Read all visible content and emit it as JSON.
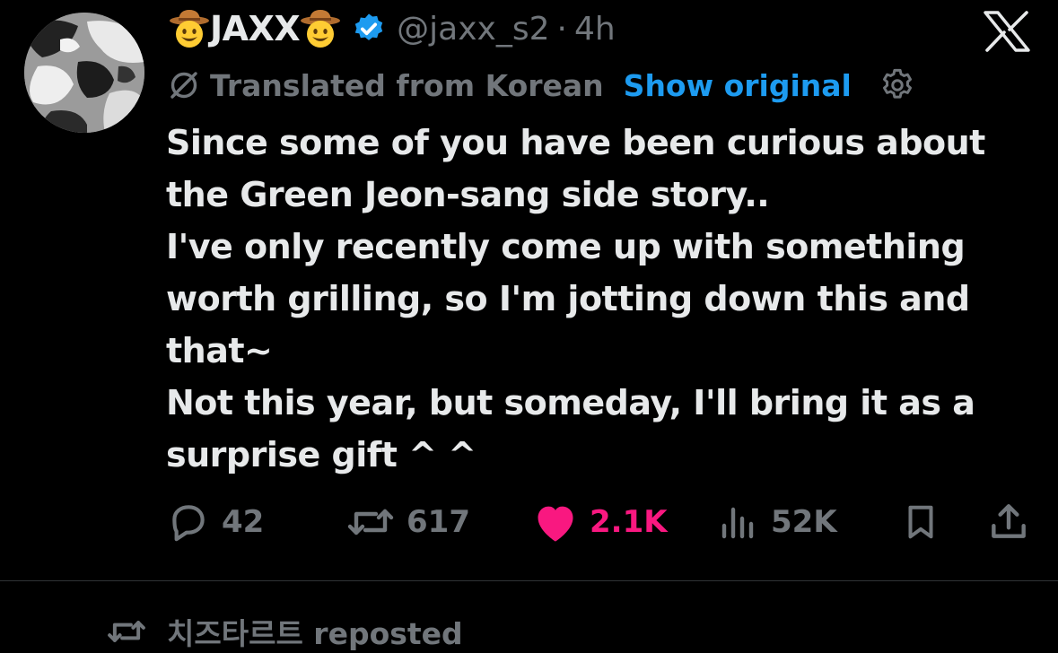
{
  "tweet": {
    "display_name": "JAXX",
    "name_emoji": "cowboy-face",
    "verified": true,
    "handle": "@jaxx_s2",
    "separator": "·",
    "time": "4h",
    "translation": {
      "label": "Translated from Korean",
      "show_original": "Show original"
    },
    "body_lines": [
      "Since some of you have been curious about",
      "the Green Jeon-sang side story..",
      "I've only recently come up with something",
      "worth grilling, so I'm jotting down this and",
      "that~",
      "Not this year, but someday, I'll bring it as a",
      "surprise gift ^ ^"
    ],
    "actions": {
      "replies": "42",
      "reposts": "617",
      "likes": "2.1K",
      "views": "52K"
    }
  },
  "next_item": {
    "reposted_by": "치즈타르트 reposted"
  },
  "colors": {
    "background": "#000000",
    "text": "#e7e9ea",
    "secondary": "#71767b",
    "link": "#1d9bf0",
    "like": "#f91880",
    "divider": "#2f3336"
  },
  "icons": [
    "cowboy-face-emoji",
    "verified-badge-icon",
    "x-logo-icon",
    "translate-icon",
    "gear-icon",
    "reply-icon",
    "repost-icon",
    "like-heart-icon",
    "views-icon",
    "bookmark-icon",
    "share-icon"
  ]
}
